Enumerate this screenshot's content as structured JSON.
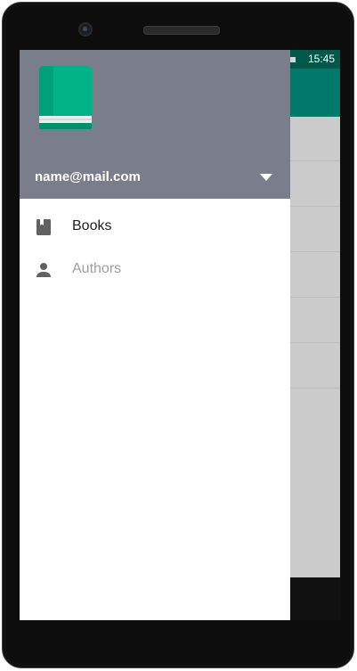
{
  "status_bar": {
    "time": "15:45"
  },
  "drawer": {
    "header": {
      "email": "name@mail.com",
      "logo_icon": "book-logo-icon",
      "dropdown_icon": "arrow-drop-down-icon"
    },
    "menu": [
      {
        "label": "Books",
        "icon": "book-icon",
        "active": true
      },
      {
        "label": "Authors",
        "icon": "person-icon",
        "active": false
      }
    ]
  },
  "colors": {
    "header_bg": "#7a7e8a",
    "app_bar": "#00796b",
    "status_bar": "#00584b",
    "logo_green": "#00b386"
  }
}
